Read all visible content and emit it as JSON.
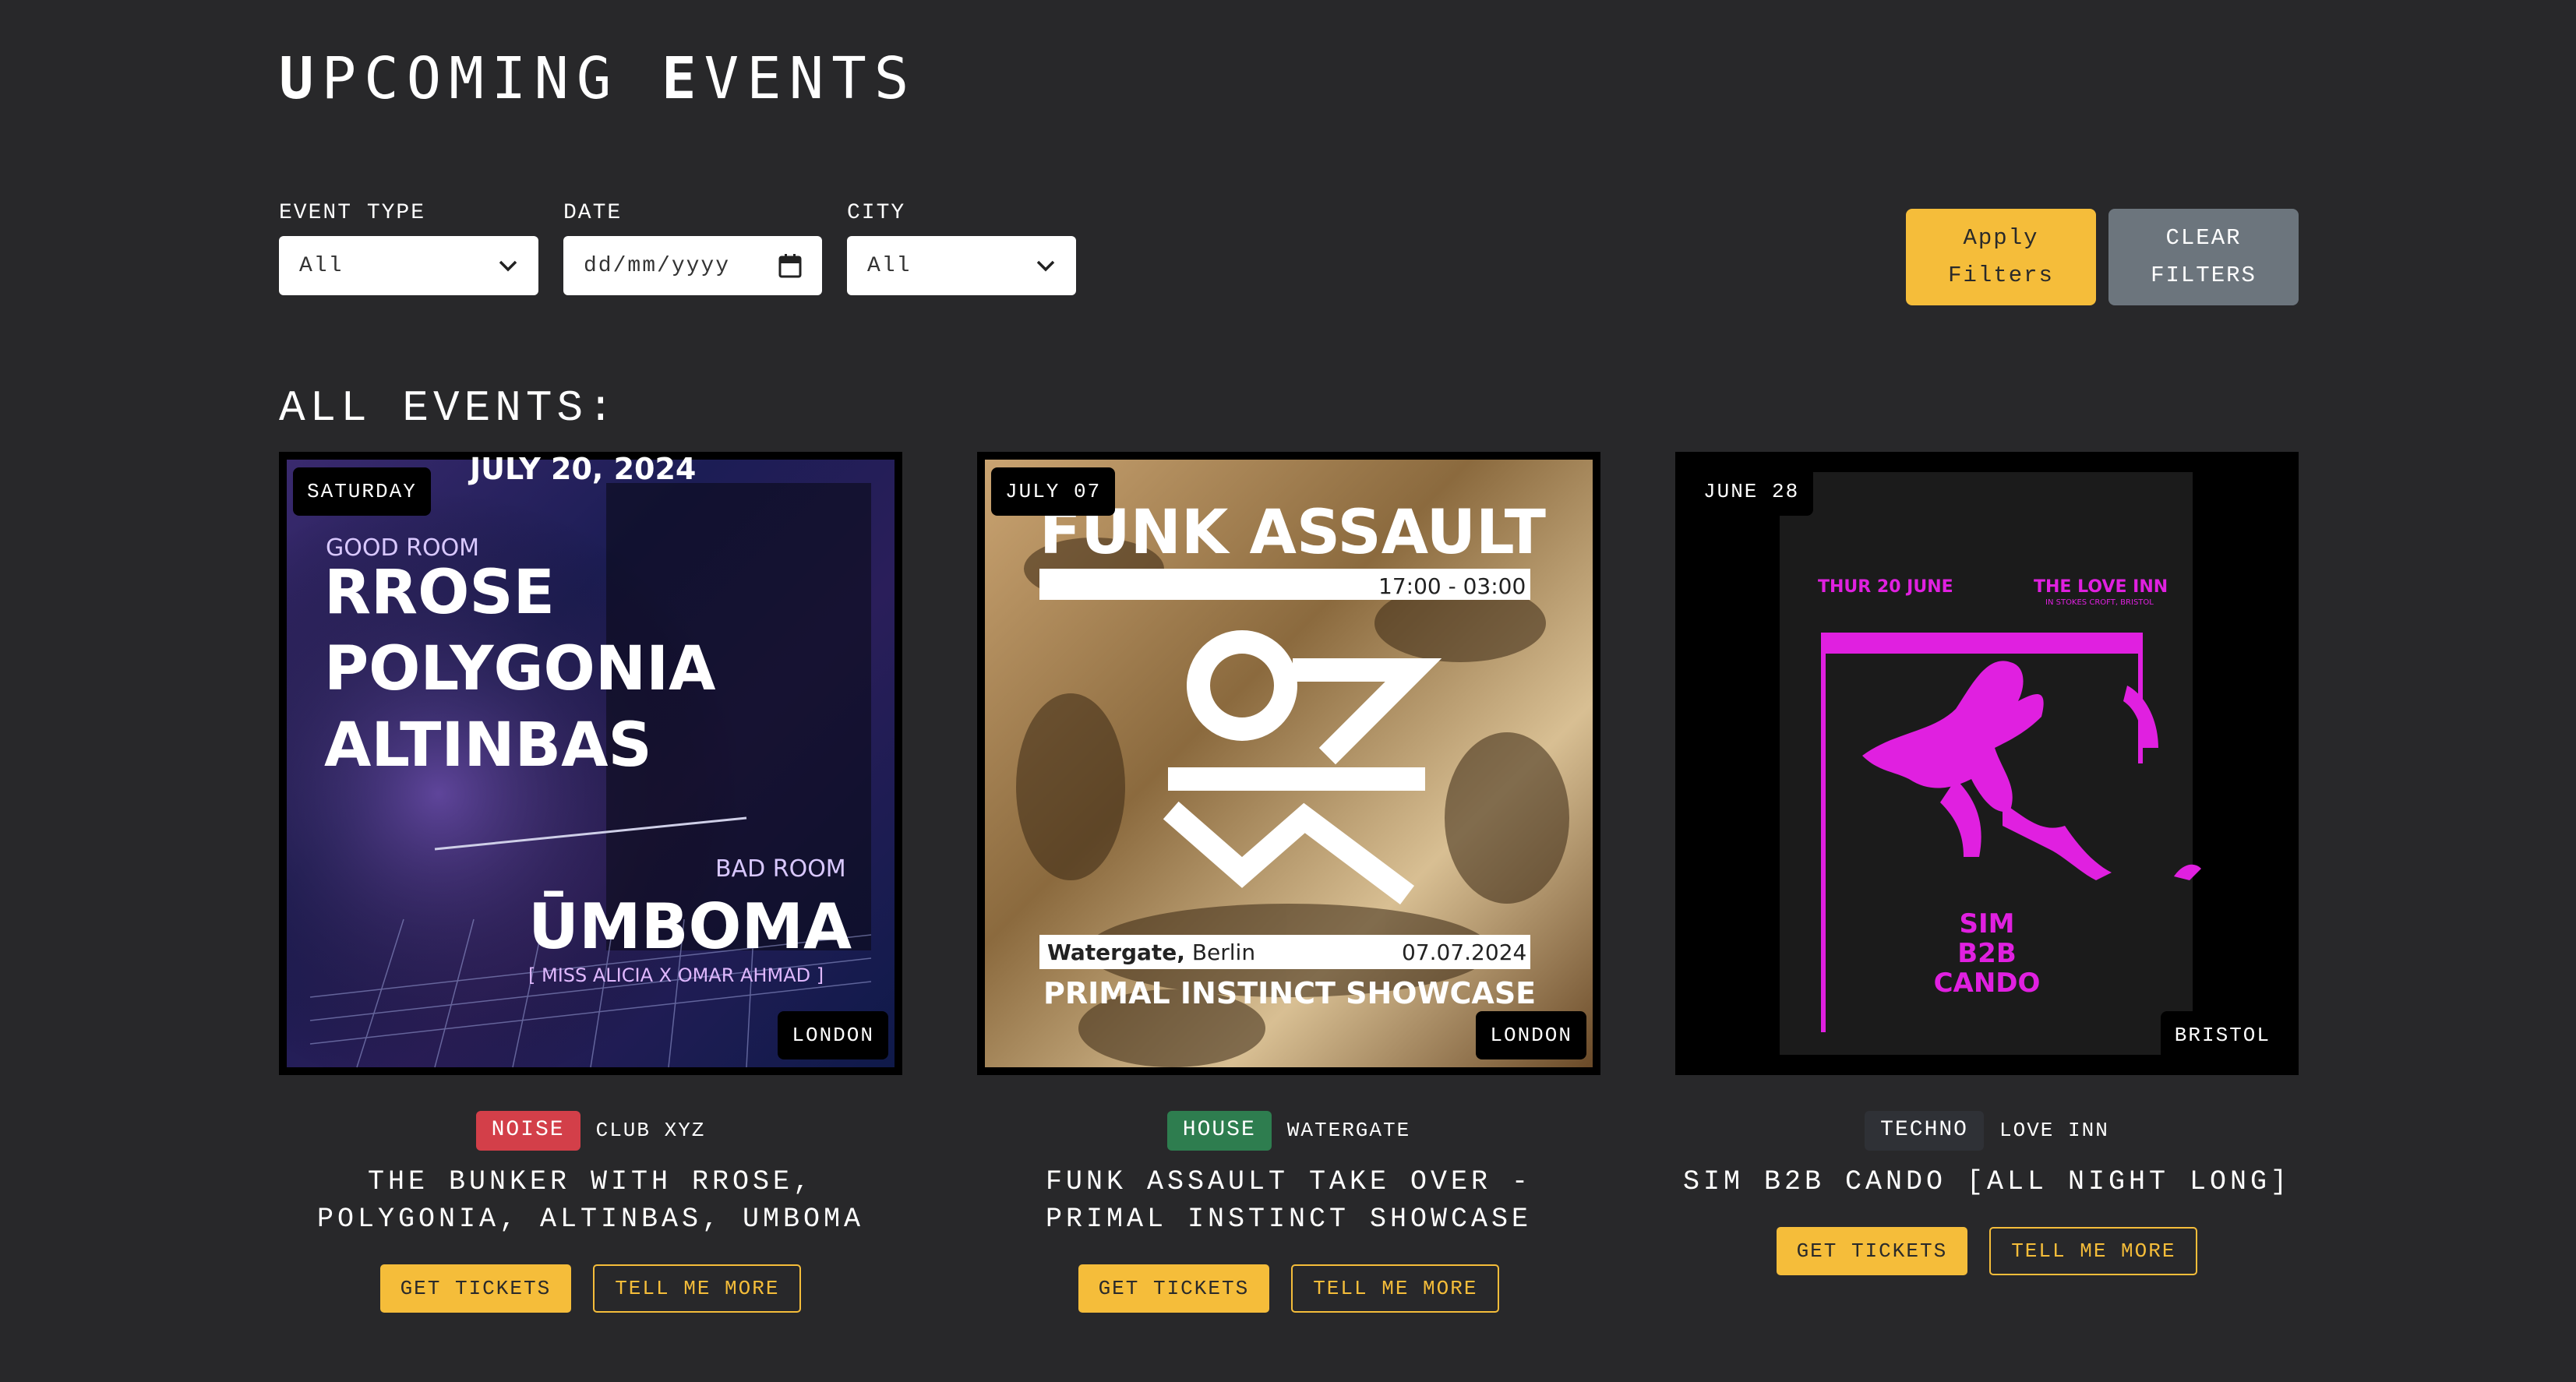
{
  "header": {
    "title_first_cap": "U",
    "title_first_rest": "PCOMING",
    "title_second_cap": "E",
    "title_second_rest": "VENTS"
  },
  "filters": {
    "event_type": {
      "label": "EVENT TYPE",
      "value": "All",
      "icon": "chevron-down-icon"
    },
    "date": {
      "label": "DATE",
      "placeholder": "dd/mm/yyyy",
      "icon": "calendar-icon"
    },
    "city": {
      "label": "CITY",
      "value": "All",
      "icon": "chevron-down-icon"
    },
    "apply_label": "Apply Filters",
    "clear_label": "CLEAR FILTERS"
  },
  "section_heading": "ALL EVENTS:",
  "colors": {
    "background": "#28282a",
    "accent": "#f5bd3a",
    "clear_button": "#6c757d",
    "noise": "#d33f49",
    "house": "#2e7d4f",
    "techno": "#2f3136"
  },
  "events": [
    {
      "day_badge": "SATURDAY",
      "city": "LONDON",
      "genre": "NOISE",
      "venue": "CLUB XYZ",
      "title": "THE BUNKER WITH RROSE, POLYGONIA, ALTINBAS, UMBOMA",
      "tickets_label": "GET TICKETS",
      "more_label": "TELL ME MORE",
      "poster": {
        "date": "JULY 20, 2024",
        "room1": "GOOD ROOM",
        "line1": "RROSE",
        "line2": "POLYGONIA",
        "line3": "ALTINBAS",
        "room2": "BAD ROOM",
        "headliner": "ŪMBOMA",
        "support": "[ MISS ALICIA X OMAR AHMAD ]"
      }
    },
    {
      "day_badge": "JULY 07",
      "city": "LONDON",
      "genre": "HOUSE",
      "venue": "WATERGATE",
      "title": "FUNK ASSAULT TAKE OVER - PRIMAL INSTINCT SHOWCASE",
      "tickets_label": "GET TICKETS",
      "more_label": "TELL ME MORE",
      "poster": {
        "headline": "FUNK ASSAULT",
        "time": "17:00 - 03:00",
        "venue_bold": "Watergate,",
        "venue_city": " Berlin",
        "date": "07.07.2024",
        "showcase": "PRIMAL INSTINCT SHOWCASE"
      }
    },
    {
      "day_badge": "JUNE 28",
      "city": "BRISTOL",
      "genre": "TECHNO",
      "venue": "LOVE INN",
      "title": "SIM B2B CANDO [ALL NIGHT LONG]",
      "tickets_label": "GET TICKETS",
      "more_label": "TELL ME MORE",
      "poster": {
        "date": "THUR 20 JUNE",
        "venue": "THE LOVE INN",
        "venue_sub": "IN STOKES CROFT, BRISTOL",
        "line1": "SIM",
        "line2": "B2B",
        "line3": "CANDO"
      }
    }
  ]
}
